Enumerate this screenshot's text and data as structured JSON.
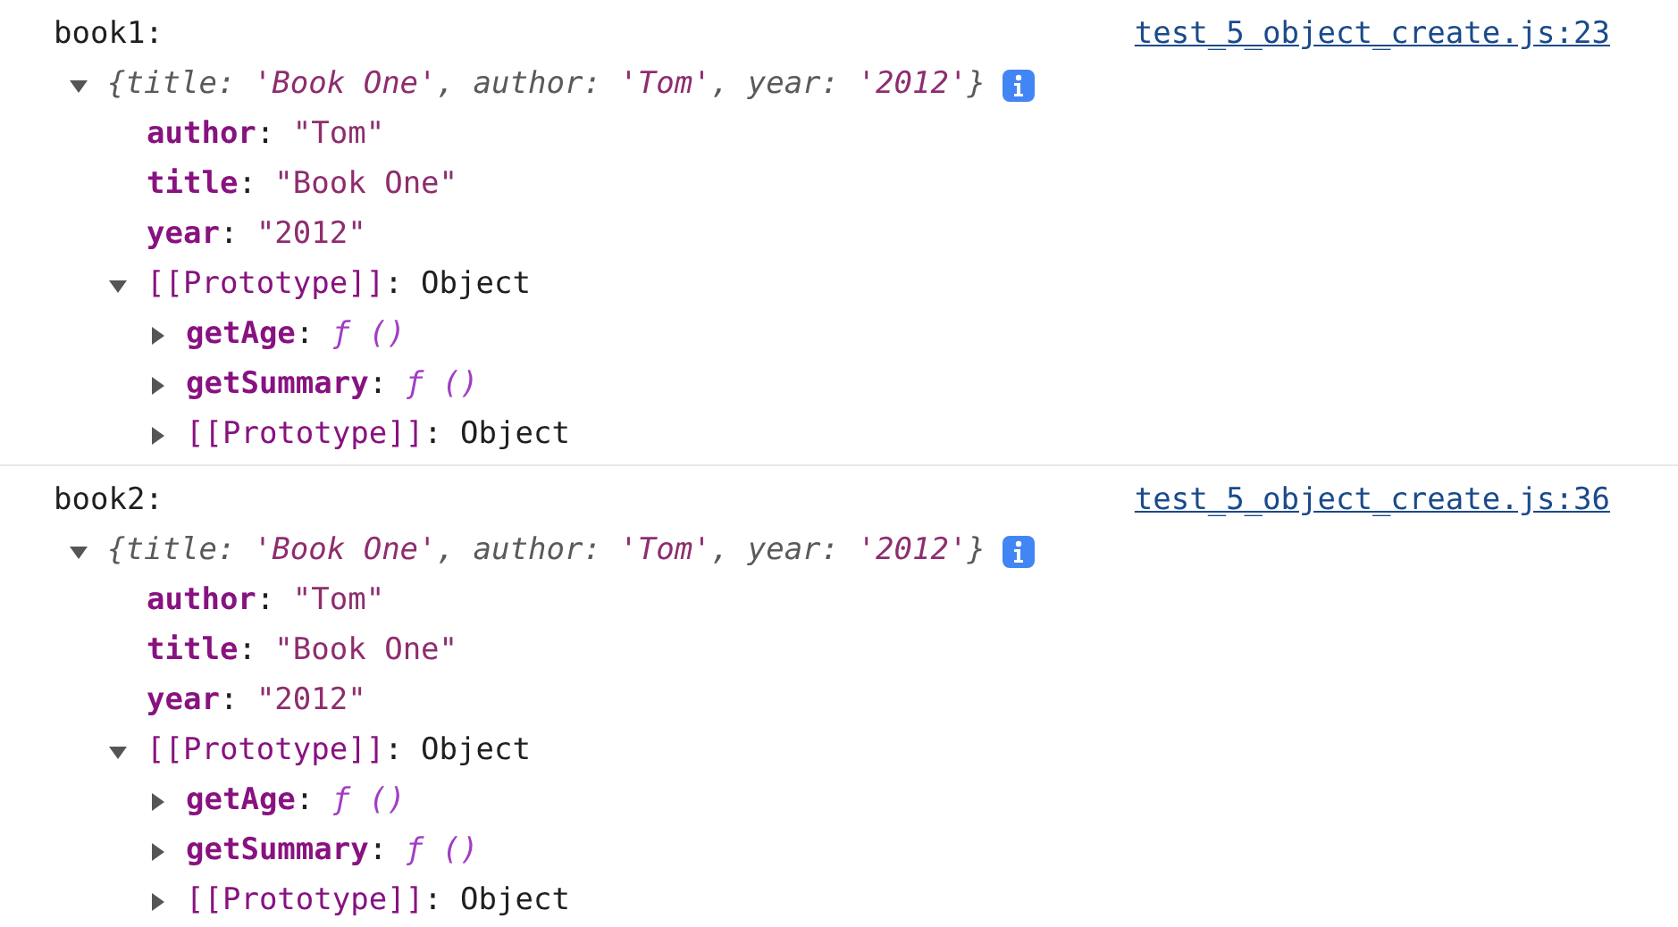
{
  "entries": [
    {
      "label": "book1:",
      "source": "test_5_object_create.js:23",
      "expanded": true,
      "summary": [
        {
          "text": "{",
          "kind": "punct"
        },
        {
          "text": "title",
          "kind": "key"
        },
        {
          "text": ": ",
          "kind": "punct"
        },
        {
          "text": "'Book One'",
          "kind": "value"
        },
        {
          "text": ", ",
          "kind": "punct"
        },
        {
          "text": "author",
          "kind": "key"
        },
        {
          "text": ": ",
          "kind": "punct"
        },
        {
          "text": "'Tom'",
          "kind": "value"
        },
        {
          "text": ", ",
          "kind": "punct"
        },
        {
          "text": "year",
          "kind": "key"
        },
        {
          "text": ": ",
          "kind": "punct"
        },
        {
          "text": "'2012'",
          "kind": "value"
        },
        {
          "text": "}",
          "kind": "punct"
        }
      ],
      "properties": [
        {
          "key": "author",
          "sep": ":",
          "value": "\"Tom\"",
          "kind": "string"
        },
        {
          "key": "title",
          "sep": ":",
          "value": "\"Book One\"",
          "kind": "string"
        },
        {
          "key": "year",
          "sep": ":",
          "value": "\"2012\"",
          "kind": "string"
        }
      ],
      "prototype": {
        "key": "[[Prototype]]",
        "sep": ":",
        "value": "Object",
        "expanded": true,
        "children": [
          {
            "key": "getAge",
            "sep": ":",
            "value": "ƒ ()",
            "kind": "function",
            "expanded": false
          },
          {
            "key": "getSummary",
            "sep": ":",
            "value": "ƒ ()",
            "kind": "function",
            "expanded": false
          },
          {
            "key": "[[Prototype]]",
            "sep": ":",
            "value": "Object",
            "kind": "internal",
            "expanded": false
          }
        ]
      }
    },
    {
      "label": "book2:",
      "source": "test_5_object_create.js:36",
      "expanded": true,
      "summary": [
        {
          "text": "{",
          "kind": "punct"
        },
        {
          "text": "title",
          "kind": "key"
        },
        {
          "text": ": ",
          "kind": "punct"
        },
        {
          "text": "'Book One'",
          "kind": "value"
        },
        {
          "text": ", ",
          "kind": "punct"
        },
        {
          "text": "author",
          "kind": "key"
        },
        {
          "text": ": ",
          "kind": "punct"
        },
        {
          "text": "'Tom'",
          "kind": "value"
        },
        {
          "text": ", ",
          "kind": "punct"
        },
        {
          "text": "year",
          "kind": "key"
        },
        {
          "text": ": ",
          "kind": "punct"
        },
        {
          "text": "'2012'",
          "kind": "value"
        },
        {
          "text": "}",
          "kind": "punct"
        }
      ],
      "properties": [
        {
          "key": "author",
          "sep": ":",
          "value": "\"Tom\"",
          "kind": "string"
        },
        {
          "key": "title",
          "sep": ":",
          "value": "\"Book One\"",
          "kind": "string"
        },
        {
          "key": "year",
          "sep": ":",
          "value": "\"2012\"",
          "kind": "string"
        }
      ],
      "prototype": {
        "key": "[[Prototype]]",
        "sep": ":",
        "value": "Object",
        "expanded": true,
        "children": [
          {
            "key": "getAge",
            "sep": ":",
            "value": "ƒ ()",
            "kind": "function",
            "expanded": false
          },
          {
            "key": "getSummary",
            "sep": ":",
            "value": "ƒ ()",
            "kind": "function",
            "expanded": false
          },
          {
            "key": "[[Prototype]]",
            "sep": ":",
            "value": "Object",
            "kind": "internal",
            "expanded": false
          }
        ]
      }
    }
  ]
}
